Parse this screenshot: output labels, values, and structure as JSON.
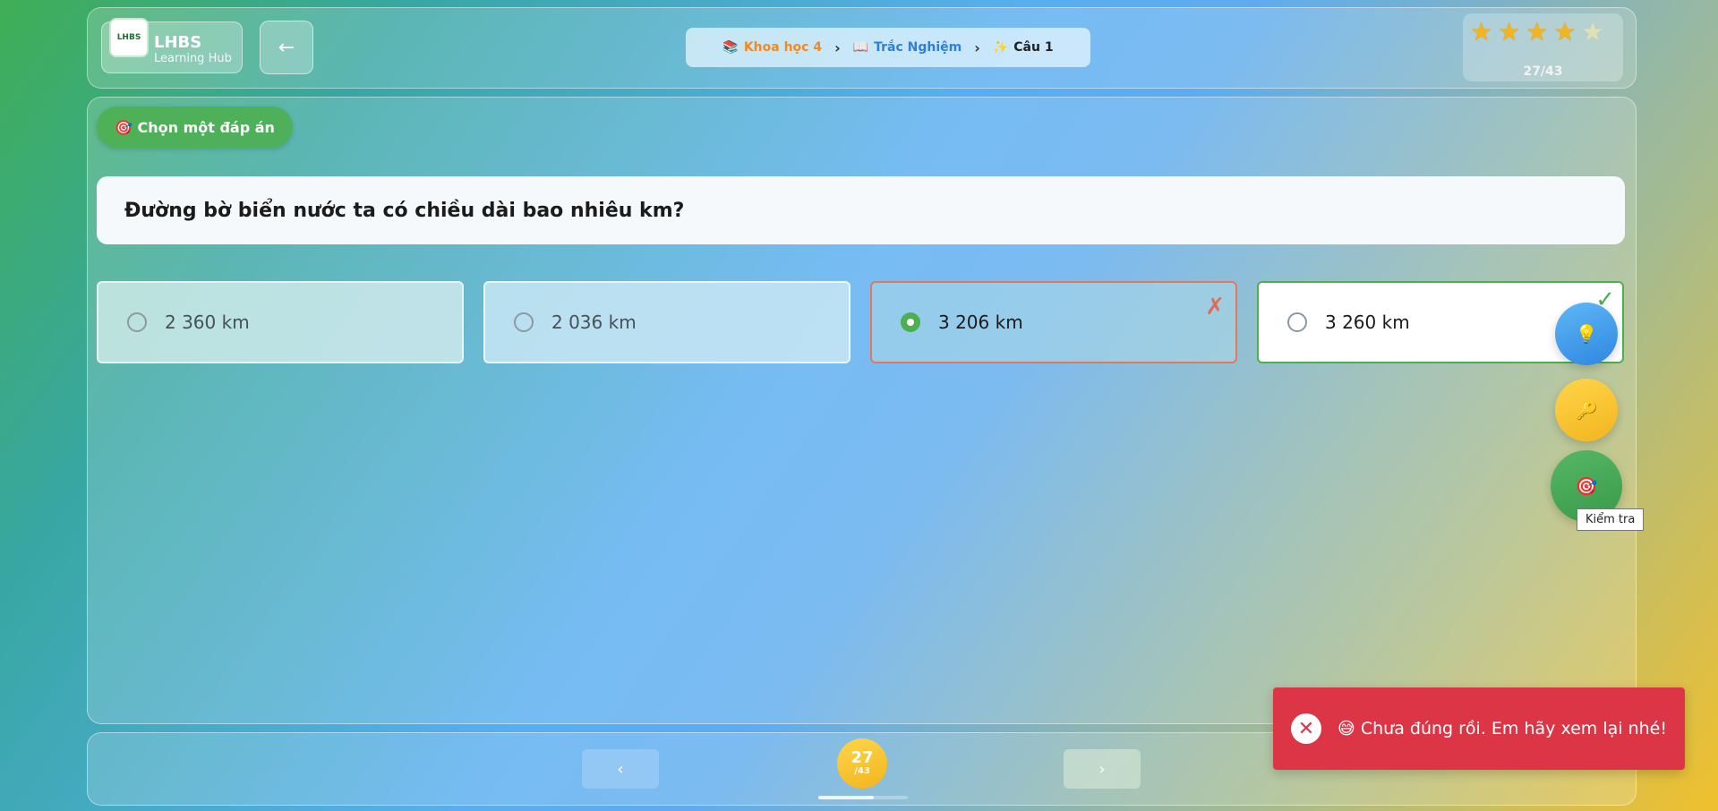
{
  "header": {
    "logo_text": "LHBS",
    "app_name": "LHBS",
    "app_subtitle": "Learning Hub",
    "back_icon": "←",
    "breadcrumb": [
      {
        "icon": "📚",
        "label": "Khoa học 4",
        "color": "#f08a24"
      },
      {
        "icon": "📖",
        "label": "Trắc Nghiệm",
        "color": "#2f7fd8"
      },
      {
        "icon": "✨",
        "label": "Câu 1",
        "color": "#222222"
      }
    ],
    "breadcrumb_sep": "›",
    "stars_filled": 4,
    "stars_total": 5,
    "progress": "27/43"
  },
  "main": {
    "instruction": "🎯 Chọn một đáp án",
    "question": "Đường bờ biển nước ta có chiều dài bao nhiêu km?",
    "options": [
      {
        "label": "2 360 km",
        "state": "default"
      },
      {
        "label": "2 036 km",
        "state": "default"
      },
      {
        "label": "3 206 km",
        "state": "selected-wrong",
        "mark": "✗"
      },
      {
        "label": "3 260 km",
        "state": "correct",
        "mark": "✓"
      }
    ]
  },
  "fabs": {
    "hint_icon": "💡",
    "key_icon": "🔑",
    "check_icon": "🎯",
    "check_tooltip": "Kiểm tra"
  },
  "footer": {
    "prev_icon": "‹",
    "next_icon": "›",
    "current": "27",
    "total": "/43"
  },
  "toast": {
    "icon": "✕",
    "message": "😅 Chưa đúng rồi. Em hãy xem lại nhé!"
  }
}
